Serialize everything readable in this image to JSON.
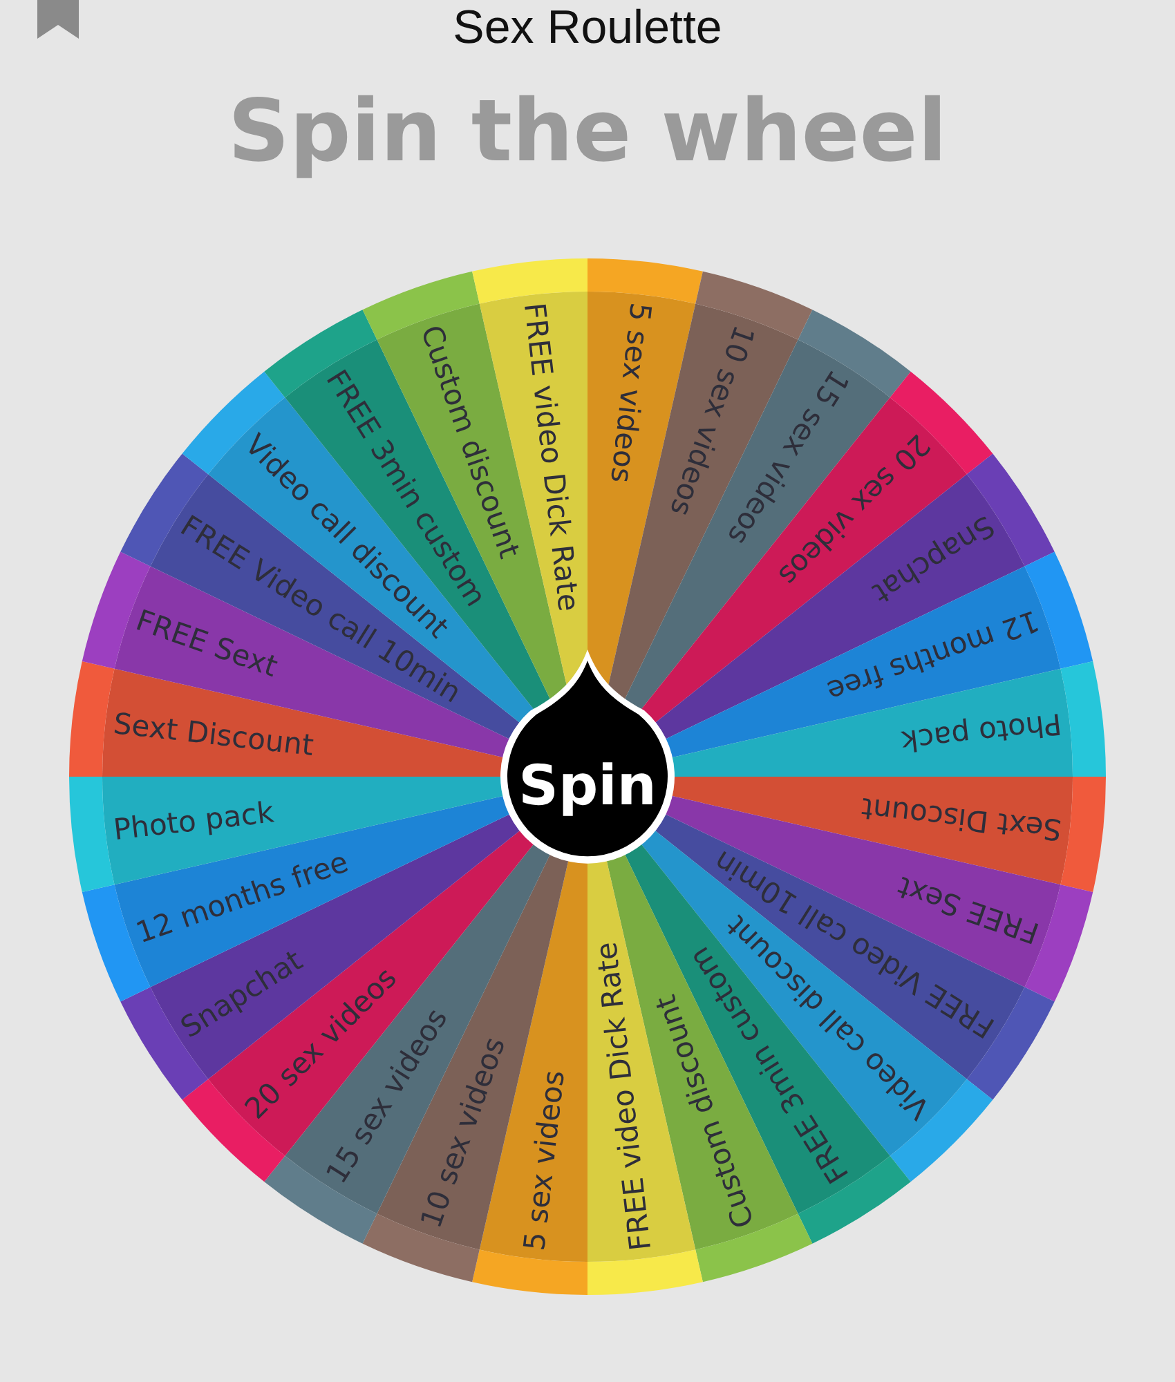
{
  "app_bar": {
    "title": "Sex Roulette"
  },
  "heading": "Spin the wheel",
  "wheel": {
    "button": "Spin",
    "segments": [
      {
        "label": "5 sex videos",
        "color": "#f5a623"
      },
      {
        "label": "10 sex videos",
        "color": "#8d6e63"
      },
      {
        "label": "15 sex videos",
        "color": "#607d8b"
      },
      {
        "label": "20 sex videos",
        "color": "#e91e63"
      },
      {
        "label": "Snapchat",
        "color": "#6a3fb5"
      },
      {
        "label": "12 months free",
        "color": "#2196f3"
      },
      {
        "label": "Photo pack",
        "color": "#26c6da"
      },
      {
        "label": "Sext Discount",
        "color": "#f05a3c"
      },
      {
        "label": "FREE Sext",
        "color": "#9c3fc0"
      },
      {
        "label": "FREE Video call 10min",
        "color": "#4f56b5"
      },
      {
        "label": "Video call discount",
        "color": "#29a9e8"
      },
      {
        "label": "FREE 3min custom",
        "color": "#1ea38a"
      },
      {
        "label": "Custom discount",
        "color": "#8bc34a"
      },
      {
        "label": "FREE video Dick Rate",
        "color": "#f7e94a"
      },
      {
        "label": "5 sex videos",
        "color": "#f5a623"
      },
      {
        "label": "10 sex videos",
        "color": "#8d6e63"
      },
      {
        "label": "15 sex videos",
        "color": "#607d8b"
      },
      {
        "label": "20 sex videos",
        "color": "#e91e63"
      },
      {
        "label": "Snapchat",
        "color": "#6a3fb5"
      },
      {
        "label": "12 months free",
        "color": "#2196f3"
      },
      {
        "label": "Photo pack",
        "color": "#26c6da"
      },
      {
        "label": "Sext Discount",
        "color": "#f05a3c"
      },
      {
        "label": "FREE Sext",
        "color": "#9c3fc0"
      },
      {
        "label": "FREE Video call 10min",
        "color": "#4f56b5"
      },
      {
        "label": "Video call discount",
        "color": "#29a9e8"
      },
      {
        "label": "FREE 3min custom",
        "color": "#1ea38a"
      },
      {
        "label": "Custom discount",
        "color": "#8bc34a"
      },
      {
        "label": "FREE video Dick Rate",
        "color": "#f7e94a"
      }
    ]
  }
}
